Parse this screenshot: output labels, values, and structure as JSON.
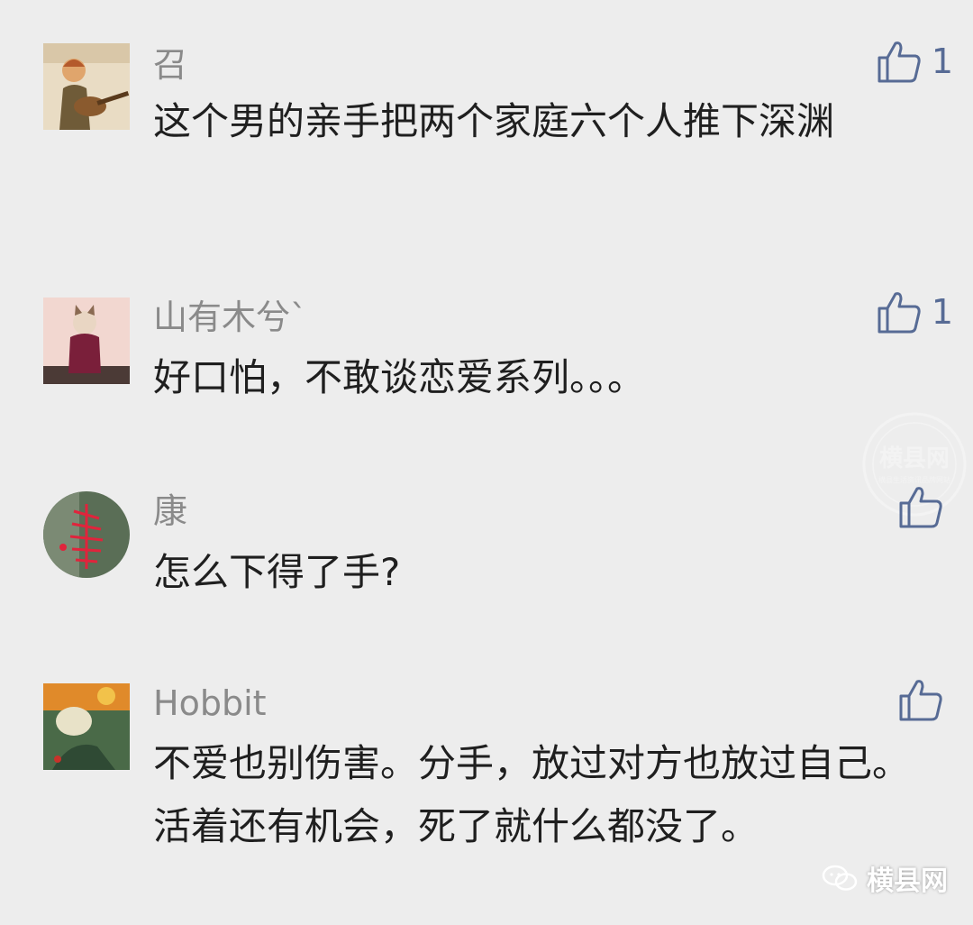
{
  "comments": [
    {
      "name": "召",
      "text": "这个男的亲手把两个家庭六个人推下深渊",
      "likes": "1",
      "avatar_icon": "guitar-player-avatar"
    },
    {
      "name": "山有木兮`",
      "text": "好口怕，不敢谈恋爱系列。。。",
      "likes": "1",
      "avatar_icon": "cat-in-sweater-avatar"
    },
    {
      "name": "康",
      "text": "怎么下得了手?",
      "likes": "",
      "avatar_icon": "red-flower-avatar"
    },
    {
      "name": "Hobbit",
      "text": "不爱也别伤害。分手，放过对方也放过自己。活着还有机会，死了就什么都没了。",
      "likes": "",
      "avatar_icon": "painting-avatar"
    }
  ],
  "watermark": {
    "stamp_title": "横县网",
    "stamp_subtitle": "横县生活资讯品牌网站",
    "brand_label": "横县网"
  },
  "colors": {
    "like_accent": "#576b95",
    "background": "#ededed"
  }
}
